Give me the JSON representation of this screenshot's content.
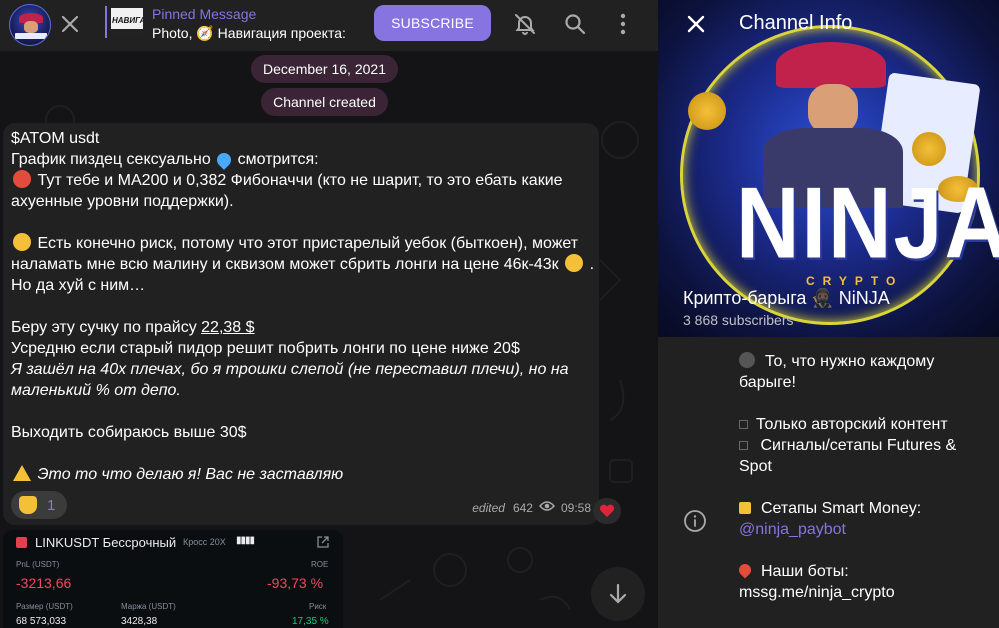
{
  "topbar": {
    "pinned_label": "Pinned Message",
    "pinned_text": "Photo, 🧭  Навигация проекта:",
    "pinned_thumb_text": "НАВИГА",
    "subscribe_label": "SUBSCRIBE"
  },
  "chat": {
    "date_chip": "December 16, 2021",
    "created_chip": "Channel created",
    "message": {
      "line1": "$ATOM usdt",
      "line2a": "График пиздец сексуально",
      "line2b": "смотрится:",
      "line3a": " Тут тебе и МА200 и 0,382 Фибоначчи (кто не шарит, то это ебать какие",
      "line3b": "ахуенные уровни поддержки).",
      "line5a": " Есть конечно риск, потому что этот пристарелый уебок (быткоен), может",
      "line5b": "наламать мне всю малину и сквизом может сбрить лонги на цене 46к-43к",
      "line5c": ".",
      "line5d": "Но да хуй с ним…",
      "line7a": "Беру эту сучку по прайсу ",
      "line7b": "22,38 $",
      "line8": "Усредню если старый пидор решит побрить лонги по цене ниже 20$",
      "line9": "Я зашёл на 40х плечах, бо я трошки слепой (не переставил плечи), но на",
      "line10": "маленький % от депо.",
      "line12": "Выходить собираюсь выше 30$",
      "line14": " Это то что делаю я! Вас не заставляю",
      "reaction_count": "1",
      "edited": "edited",
      "views": "642",
      "time": "09:58"
    },
    "card": {
      "title": "LINKUSDT Бессрочный",
      "cross": "Кросс 20X",
      "pnl_label": "PnL (USDT)",
      "pnl_value": "-3213,66",
      "roe_label": "ROE",
      "roe_value": "-93,73 %",
      "size_label": "Размер (USDT)",
      "size_value": "68 573,033",
      "margin_label": "Маржа (USDT)",
      "margin_value": "3428,38",
      "risk_label": "Риск",
      "risk_value": "17,35 %"
    }
  },
  "info": {
    "title": "Channel Info",
    "channel_name": "Крипто-барыга 🥷🏿 NiNJA",
    "subscribers": "3 868 subscribers",
    "logo_word": "NINJA",
    "logo_sub": "CRYPTO",
    "desc": {
      "l1": "То, что нужно каждому",
      "l2": "барыге!",
      "l3": "Только авторский контент",
      "l4a": "Сигналы/сетапы Futures &",
      "l4b": "Spot",
      "l5": "Сетапы Smart Money:",
      "l5_link": "@ninja_paybot",
      "l6": "Наши боты:",
      "l6_link": "mssg.me/ninja_crypto"
    }
  },
  "colors": {
    "accent": "#8774e1",
    "panel": "#212121",
    "chip": "#3a2435",
    "loss": "#f6465d",
    "gain": "#0ecb81"
  }
}
